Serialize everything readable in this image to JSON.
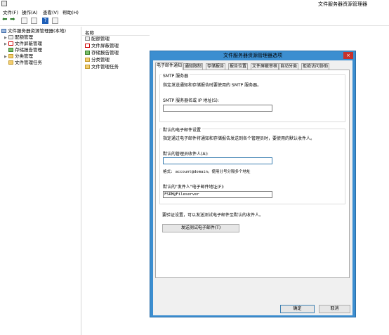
{
  "app": {
    "title": "文件服务器资源管理器"
  },
  "menu": [
    "文件(F)",
    "操作(A)",
    "查看(V)",
    "帮助(H)"
  ],
  "tree": {
    "root": "文件服务器资源管理器(本地)",
    "items": [
      "配额管理",
      "文件屏蔽管理",
      "存储报告管理",
      "分类管理",
      "文件管理任务"
    ]
  },
  "list": {
    "header": "名称",
    "items": [
      "配额管理",
      "文件屏蔽管理",
      "存储报告管理",
      "分类管理",
      "文件管理任务"
    ]
  },
  "dialog": {
    "title": "文件服务器资源管理器选项",
    "close_label": "×",
    "tabs": [
      "电子邮件通知",
      "通知限制",
      "存储报告",
      "报告位置",
      "文件屏蔽审核",
      "自动分类",
      "拒绝访问协助"
    ],
    "smtp": {
      "group_title": "SMTP 服务器",
      "description": "指定发送通知和存储报告时要使用的 SMTP 服务器。",
      "field_label": "SMTP 服务器名或 IP 地址(S):",
      "field_value": ""
    },
    "defaults": {
      "group_title": "默认的电子邮件设置",
      "description": "指定通过电子邮件将通知和存储报告发送到各个管理员时，要使用的默认收件人。",
      "admin_label": "默认的管理员收件人(A):",
      "admin_value": "",
      "format_hint": "格式: account@domain。使用分号分隔多个地址",
      "sender_label": "默认的\"发件人\"电子邮件地址(F):",
      "sender_value": "FSRM@Fileserver"
    },
    "test_note": "要验证设置，可以发送测试电子邮件至默认的收件人。",
    "test_button": "发送测试电子邮件(T)",
    "ok_button": "确定",
    "cancel_button": "取消"
  }
}
